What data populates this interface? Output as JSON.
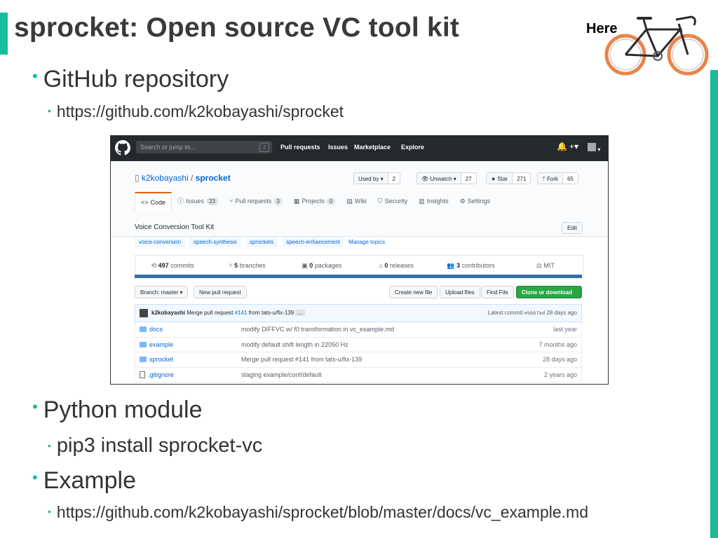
{
  "slide": {
    "title": "sprocket: Open source VC tool kit",
    "here_label": "Here",
    "bullets": [
      {
        "text": "GitHub repository"
      },
      {
        "text": "https://github.com/k2kobayashi/sprocket"
      },
      {
        "text": "Python module"
      },
      {
        "text": "pip3 install sprocket-vc"
      },
      {
        "text": "Example"
      },
      {
        "text": "https://github.com/k2kobayashi/sprocket/blob/master/docs/vc_example.md"
      }
    ],
    "colors": {
      "accent": "#1abc9c",
      "title": "#3a3a3a",
      "bike_frame": "#2b2b2b",
      "bike_tire": "#e8844a"
    }
  },
  "github": {
    "nav": {
      "search_placeholder": "Search or jump to...",
      "slash_hint": "/",
      "links": [
        "Pull requests",
        "Issues",
        "Marketplace",
        "Explore"
      ],
      "plus": "+▾"
    },
    "repo": {
      "owner": "k2kobayashi",
      "separator": " / ",
      "name": "sprocket",
      "used_by_label": "Used by ▾",
      "used_by_count": "2",
      "watch_label": "Unwatch ▾",
      "watch_count": "27",
      "star_label": "Star",
      "star_count": "271",
      "fork_label": "Fork",
      "fork_count": "65"
    },
    "tabs": [
      {
        "label": "Code",
        "count": ""
      },
      {
        "label": "Issues",
        "count": "23"
      },
      {
        "label": "Pull requests",
        "count": "3"
      },
      {
        "label": "Projects",
        "count": "0"
      },
      {
        "label": "Wiki",
        "count": ""
      },
      {
        "label": "Security",
        "count": ""
      },
      {
        "label": "Insights",
        "count": ""
      },
      {
        "label": "Settings",
        "count": ""
      }
    ],
    "description": "Voice Conversion Tool Kit",
    "edit_label": "Edit",
    "topics": [
      "voice-conversion",
      "speech-synthesis",
      "sprockets",
      "speech-enhancement"
    ],
    "manage_topics": "Manage topics",
    "stats": [
      {
        "num": "497",
        "label": " commits"
      },
      {
        "num": "5",
        "label": " branches"
      },
      {
        "num": "0",
        "label": " packages"
      },
      {
        "num": "0",
        "label": " releases"
      },
      {
        "num": "3",
        "label": " contributors"
      },
      {
        "num": "",
        "label": "MIT"
      }
    ],
    "actions": {
      "branch": "Branch: master ▾",
      "new_pr": "New pull request",
      "create_file": "Create new file",
      "upload_files": "Upload files",
      "find_file": "Find File",
      "clone": "Clone or download ▾"
    },
    "latest_commit": {
      "author": "k2kobayashi",
      "message_prefix": " Merge pull request ",
      "pr_link": "#141",
      "message_suffix": " from tats-u/fix-139",
      "ellipsis": "…",
      "latest_label": "Latest commit ",
      "sha": "ebbb7ad",
      "age": " 28 days ago"
    },
    "files": [
      {
        "name": "docs",
        "type": "dir",
        "message": "modify DIFFVC w/ f0 transformation in vc_example.md",
        "age": "last year"
      },
      {
        "name": "example",
        "type": "dir",
        "message": "modify default shift length in 22050 Hz",
        "age": "7 months ago"
      },
      {
        "name": "sprocket",
        "type": "dir",
        "message": "Merge pull request #141 from tats-u/fix-139",
        "age": "28 days ago"
      },
      {
        "name": ".gitignore",
        "type": "file",
        "message": "staging example/conf/default",
        "age": "2 years ago"
      }
    ]
  }
}
